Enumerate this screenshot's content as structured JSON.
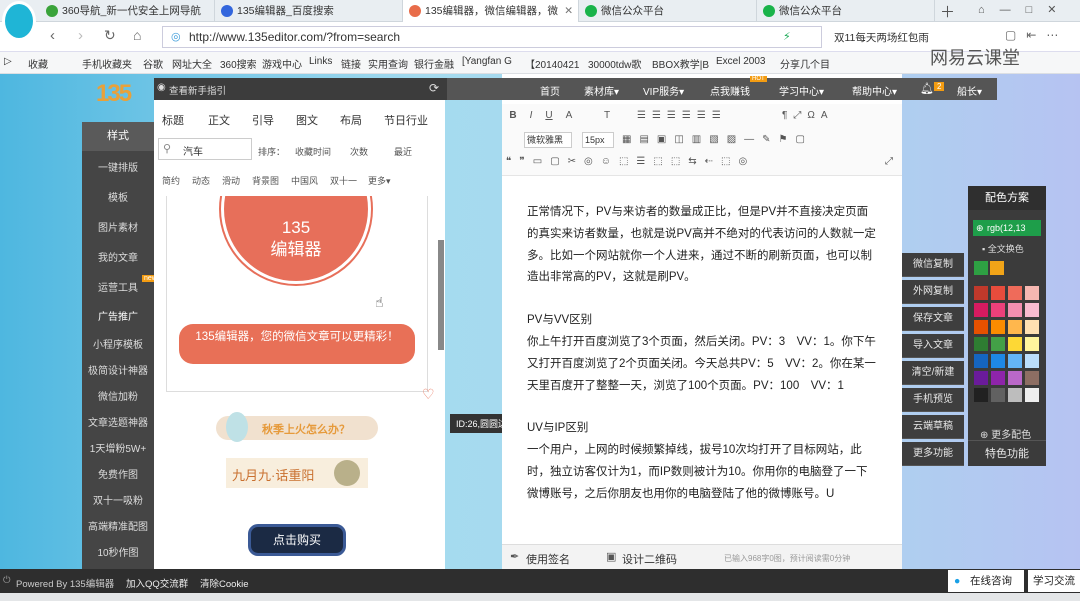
{
  "browser": {
    "tabs": [
      {
        "title": "360导航_新一代安全上网导航",
        "color": "#3aa33a"
      },
      {
        "title": "135编辑器_百度搜索",
        "color": "#3366dd"
      },
      {
        "title": "135编辑器，微信编辑器，微",
        "color": "#e86c4a"
      },
      {
        "title": "微信公众平台",
        "color": "#19b34a"
      },
      {
        "title": "微信公众平台",
        "color": "#19b34a"
      }
    ],
    "url": "http://www.135editor.com/?from=search",
    "promo": "双11每天两场红包雨",
    "watermark": "网易云课堂"
  },
  "favorites": [
    "收藏",
    "手机收藏夹",
    "谷歌",
    "网址大全",
    "360搜索",
    "游戏中心",
    "Links",
    "链接",
    "实用查询",
    "银行金融",
    "[Yangfan G",
    "【20140421",
    "30000tdw歌",
    "BBOX教学|B",
    "Excel 2003",
    "分享几个目"
  ],
  "tool": {
    "guide": "查看新手指引",
    "nav": [
      "样式",
      "一键排版",
      "模板",
      "图片素材",
      "我的文章",
      "运营工具",
      "广告推广",
      "小程序模板",
      "极简设计神器",
      "微信加粉",
      "文章选题神器",
      "1天增粉5W+",
      "免费作图",
      "双十一吸粉",
      "高端精准配图",
      "10秒作图"
    ],
    "nav_badge": "new",
    "tabs": [
      "标题",
      "正文",
      "引导",
      "图文",
      "布局",
      "节日行业"
    ],
    "search_value": "汽车",
    "sort_label": "排序：",
    "sort_options": [
      "收藏时间",
      "次数",
      "最近"
    ],
    "tags": [
      "简约",
      "动态",
      "滑动",
      "背景图",
      "中国风",
      "双十一",
      "更多▾"
    ],
    "sample_circle_line1": "135",
    "sample_circle_line2": "编辑器",
    "sample_banner": "135编辑器，您的微信文章可以更精彩！",
    "style_tooltip": "ID:26,圆圆边框组合样式.",
    "sample2": "秋季上火怎么办？",
    "sample3": "九月九·话重阳",
    "buy_button": "点击购买"
  },
  "editor": {
    "menu": [
      "首页",
      "素材库▾",
      "VIP服务▾",
      "点我赚钱",
      "学习中心▾",
      "帮助中心▾",
      "船长▾"
    ],
    "hot_badge": "HOT",
    "notif_count": "2",
    "font_select": "微软雅黑",
    "size_select": "15px",
    "paragraphs": [
      "正常情况下，PV与来访者的数量成正比，但是PV并不直接决定页面的真实来访者数量，也就是说PV高并不绝对的代表访问的人数就一定多。比如一个网站就你一个人进来，通过不断的刷新页面，也可以制造出非常高的PV，这就是刷PV。",
      "",
      "PV与VV区别",
      "你上午打开百度浏览了3个页面，然后关闭。PV：3　VV：1。你下午又打开百度浏览了2个页面关闭。今天总共PV：5　VV：2。你在某一天里百度开了整整一天，浏览了100个页面。PV：100　VV：1",
      "",
      "UV与IP区别",
      "一个用户，上网的时候频繁掉线，拔号10次均打开了目标网站，此时，独立访客仅计为1，而IP数则被计为10。你用你的电脑登了一下微博账号，之后你朋友也用你的电脑登陆了他的微博账号。U"
    ],
    "bottom_left": "使用签名",
    "bottom_mid": "设计二维码",
    "bottom_right": "已输入968字0图，预计阅读需0分钟"
  },
  "side": {
    "buttons": [
      "微信复制",
      "外网复制",
      "保存文章",
      "导入文章",
      "清空/新建",
      "手机预览",
      "云端草稿",
      "更多功能"
    ],
    "palette_title": "配色方案",
    "palette_color_value": "rgb(12,13",
    "palette_all": "全文换色",
    "palette_more": "更多配色",
    "special": "特色功能",
    "swatches": [
      "#c0392b",
      "#e74c3c",
      "#ef6b5a",
      "#f5b7b1",
      "#d81b60",
      "#ec407a",
      "#f48fb1",
      "#f8bbd0",
      "#e65100",
      "#fb8c00",
      "#ffb74d",
      "#ffe0b2",
      "#2e7d32",
      "#43a047",
      "#fdd835",
      "#fff59d",
      "#1565c0",
      "#1e88e5",
      "#64b5f6",
      "#bbdefb",
      "#6a1b9a",
      "#8e24aa",
      "#ba68c8",
      "#8d6e63",
      "#212121",
      "#616161",
      "#bdbdbd",
      "#eeeeee"
    ]
  },
  "footer": {
    "powered": "Powered By 135编辑器",
    "qq": "加入QQ交流群",
    "cookie": "清除Cookie",
    "consult": "在线咨询",
    "learn": "学习交流"
  }
}
